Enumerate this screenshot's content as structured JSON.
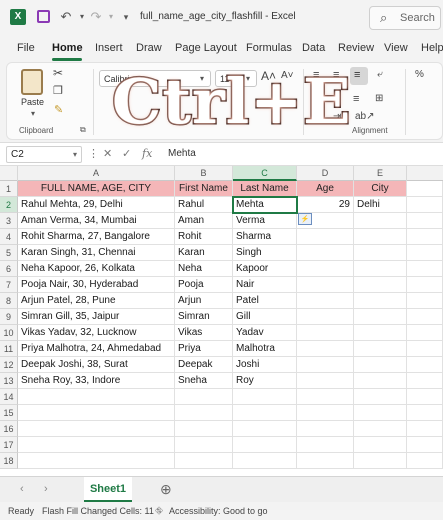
{
  "title_bar": {
    "doc_name": "full_name_age_city_flashfill",
    "app_name": "Excel",
    "search_placeholder": "Search"
  },
  "tabs": [
    "File",
    "Home",
    "Insert",
    "Draw",
    "Page Layout",
    "Formulas",
    "Data",
    "Review",
    "View",
    "Help"
  ],
  "active_tab": "Home",
  "ribbon": {
    "paste_label": "Paste",
    "clipboard_label": "Clipboard",
    "font_name": "Calibri",
    "font_size": "11",
    "alignment_label": "Alignment"
  },
  "overlay_text": "Ctrl+E",
  "formula_bar": {
    "name_box": "C2",
    "fx": "fx",
    "value": "Mehta"
  },
  "grid": {
    "columns": [
      "A",
      "B",
      "C",
      "D",
      "E"
    ],
    "selected_column": "C",
    "selected_row": 2,
    "row_numbers": [
      "1",
      "2",
      "3",
      "4",
      "5",
      "6",
      "7",
      "8",
      "9",
      "10",
      "11",
      "12",
      "13",
      "14",
      "15",
      "16",
      "17",
      "18"
    ],
    "headers": [
      "FULL NAME, AGE, CITY",
      "First Name",
      "Last Name",
      "Age",
      "City"
    ],
    "rows": [
      [
        "Rahul Mehta, 29, Delhi",
        "Rahul",
        "Mehta",
        "29",
        "Delhi"
      ],
      [
        "Aman Verma, 34, Mumbai",
        "Aman",
        "Verma",
        "",
        ""
      ],
      [
        "Rohit Sharma, 27, Bangalore",
        "Rohit",
        "Sharma",
        "",
        ""
      ],
      [
        "Karan Singh, 31, Chennai",
        "Karan",
        "Singh",
        "",
        ""
      ],
      [
        "Neha Kapoor, 26, Kolkata",
        "Neha",
        "Kapoor",
        "",
        ""
      ],
      [
        "Pooja Nair, 30, Hyderabad",
        "Pooja",
        "Nair",
        "",
        ""
      ],
      [
        "Arjun Patel, 28, Pune",
        "Arjun",
        "Patel",
        "",
        ""
      ],
      [
        "Simran Gill, 35, Jaipur",
        "Simran",
        "Gill",
        "",
        ""
      ],
      [
        "Vikas Yadav, 32, Lucknow",
        "Vikas",
        "Yadav",
        "",
        ""
      ],
      [
        "Priya Malhotra, 24, Ahmedabad",
        "Priya",
        "Malhotra",
        "",
        ""
      ],
      [
        "Deepak Joshi, 38, Surat",
        "Deepak",
        "Joshi",
        "",
        ""
      ],
      [
        "Sneha Roy, 33, Indore",
        "Sneha",
        "Roy",
        "",
        ""
      ]
    ]
  },
  "sheet_tabs": {
    "active": "Sheet1"
  },
  "status_bar": {
    "ready": "Ready",
    "flash_fill": "Flash Fill Changed Cells: 11",
    "accessibility": "Accessibility: Good to go"
  },
  "colors": {
    "excel_green": "#1f7a45",
    "header_fill": "#f4b6b8"
  }
}
